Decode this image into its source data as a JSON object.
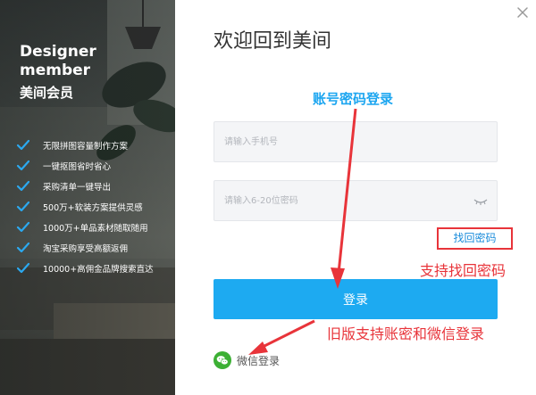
{
  "brand": {
    "name_en": "Designer member",
    "name_cn": "美间会员"
  },
  "features": [
    "无限拼图容量制作方案",
    "一键抠图省时省心",
    "采购清单一键导出",
    "500万+软装方案提供灵感",
    "1000万+单品素材随取随用",
    "淘宝采购享受高额返佣",
    "10000+高佣金品牌搜索直达"
  ],
  "login": {
    "title": "欢迎回到美间",
    "phone_placeholder": "请输入手机号",
    "password_placeholder": "请输入6-20位密码",
    "forgot_password": "找回密码",
    "submit_label": "登录",
    "wechat_label": "微信登录"
  },
  "annotations": {
    "account_login": "账号密码登录",
    "support_recover": "支持找回密码",
    "legacy_support": "旧版支持账密和微信登录"
  },
  "colors": {
    "primary": "#1daaf1",
    "annotation_red": "#e8343a",
    "annotation_blue": "#1da6f0",
    "wechat_green": "#3cb034"
  },
  "icons": {
    "close": "close-icon",
    "feature_check": "check-icon",
    "password_toggle": "eye-closed-icon",
    "wechat": "wechat-icon"
  }
}
